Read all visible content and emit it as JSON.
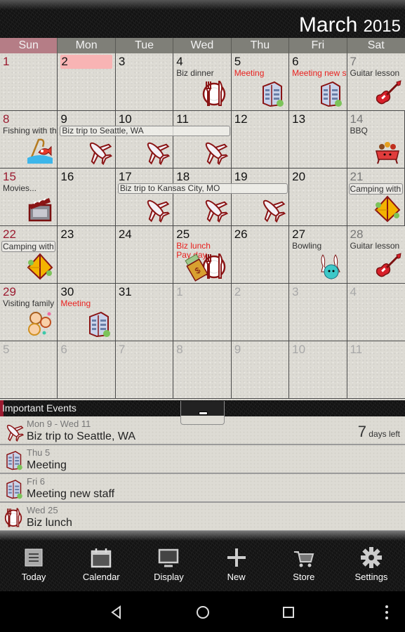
{
  "header": {
    "month": "March",
    "year": "2015"
  },
  "weekdays": [
    "Sun",
    "Mon",
    "Tue",
    "Wed",
    "Thu",
    "Fri",
    "Sat"
  ],
  "colors": {
    "sunday": "#9b1b30",
    "today_highlight": "#f8b4b4",
    "red_event": "#e8211f",
    "weekday_header": "#7f7f78",
    "sunday_header": "#b57d86"
  },
  "weeks": [
    {
      "days": [
        {
          "n": "1",
          "kind": "sun"
        },
        {
          "n": "2",
          "kind": "today"
        },
        {
          "n": "3"
        },
        {
          "n": "4",
          "events": [
            {
              "text": "Biz dinner"
            }
          ],
          "icon": "dinner"
        },
        {
          "n": "5",
          "events": [
            {
              "text": "Meeting",
              "red": true
            }
          ],
          "icon": "building"
        },
        {
          "n": "6",
          "events": [
            {
              "text": "Meeting new staff",
              "red": true
            }
          ],
          "icon": "building"
        },
        {
          "n": "7",
          "kind": "sat",
          "events": [
            {
              "text": "Guitar lesson"
            }
          ],
          "icon": "guitar"
        }
      ]
    },
    {
      "days": [
        {
          "n": "8",
          "kind": "sun",
          "events": [
            {
              "text": "Fishing with the kids"
            }
          ],
          "icon": "fishing"
        },
        {
          "n": "9",
          "icon": "plane"
        },
        {
          "n": "10",
          "icon": "plane"
        },
        {
          "n": "11",
          "icon": "plane"
        },
        {
          "n": "12"
        },
        {
          "n": "13"
        },
        {
          "n": "14",
          "kind": "sat",
          "events": [
            {
              "text": "BBQ"
            }
          ],
          "icon": "bbq"
        }
      ],
      "span": {
        "text": "Biz trip to Seattle, WA",
        "start": 1,
        "end": 3
      }
    },
    {
      "days": [
        {
          "n": "15",
          "kind": "sun",
          "events": [
            {
              "text": "Movies..."
            }
          ],
          "icon": "movie"
        },
        {
          "n": "16"
        },
        {
          "n": "17",
          "icon": "plane"
        },
        {
          "n": "18",
          "icon": "plane"
        },
        {
          "n": "19",
          "icon": "plane"
        },
        {
          "n": "20"
        },
        {
          "n": "21",
          "kind": "sat",
          "events": [
            {
              "text": "Camping with",
              "boxed": true
            }
          ],
          "icon": "tent"
        }
      ],
      "span": {
        "text": "Biz trip to Kansas City, MO",
        "start": 2,
        "end": 4
      }
    },
    {
      "days": [
        {
          "n": "22",
          "kind": "sun",
          "events": [
            {
              "text": "Camping with",
              "boxed": true
            }
          ],
          "icon": "tent"
        },
        {
          "n": "23"
        },
        {
          "n": "24"
        },
        {
          "n": "25",
          "events": [
            {
              "text": "Biz lunch",
              "red": true
            },
            {
              "text": "Pay day",
              "red": true
            }
          ],
          "icon": "dinner",
          "icon2": "money"
        },
        {
          "n": "26"
        },
        {
          "n": "27",
          "events": [
            {
              "text": "Bowling"
            }
          ],
          "icon": "bowling"
        },
        {
          "n": "28",
          "kind": "sat",
          "events": [
            {
              "text": "Guitar lesson"
            }
          ],
          "icon": "guitar"
        }
      ]
    },
    {
      "days": [
        {
          "n": "29",
          "kind": "sun",
          "events": [
            {
              "text": "Visiting family"
            }
          ],
          "icon": "family"
        },
        {
          "n": "30",
          "events": [
            {
              "text": "Meeting",
              "red": true
            }
          ],
          "icon": "building"
        },
        {
          "n": "31"
        },
        {
          "n": "1",
          "kind": "other"
        },
        {
          "n": "2",
          "kind": "other"
        },
        {
          "n": "3",
          "kind": "other"
        },
        {
          "n": "4",
          "kind": "other"
        }
      ]
    },
    {
      "days": [
        {
          "n": "5",
          "kind": "other"
        },
        {
          "n": "6",
          "kind": "other"
        },
        {
          "n": "7",
          "kind": "other"
        },
        {
          "n": "8",
          "kind": "other"
        },
        {
          "n": "9",
          "kind": "other"
        },
        {
          "n": "10",
          "kind": "other"
        },
        {
          "n": "11",
          "kind": "other"
        }
      ]
    }
  ],
  "important_events": {
    "title": "Important Events",
    "items": [
      {
        "date": "Mon 9  - Wed 11",
        "name": "Biz trip to Seattle, WA",
        "icon": "plane",
        "days_left": "7",
        "days_left_label": "days left"
      },
      {
        "date": "Thu 5",
        "name": "Meeting",
        "icon": "building"
      },
      {
        "date": "Fri 6",
        "name": "Meeting new staff",
        "icon": "building"
      },
      {
        "date": "Wed 25",
        "name": "Biz lunch",
        "icon": "dinner"
      }
    ]
  },
  "toolbar": [
    {
      "label": "Today",
      "icon": "list-icon"
    },
    {
      "label": "Calendar",
      "icon": "calendar-icon"
    },
    {
      "label": "Display",
      "icon": "monitor-icon"
    },
    {
      "label": "New",
      "icon": "plus-icon"
    },
    {
      "label": "Store",
      "icon": "cart-icon"
    },
    {
      "label": "Settings",
      "icon": "gear-icon"
    }
  ]
}
